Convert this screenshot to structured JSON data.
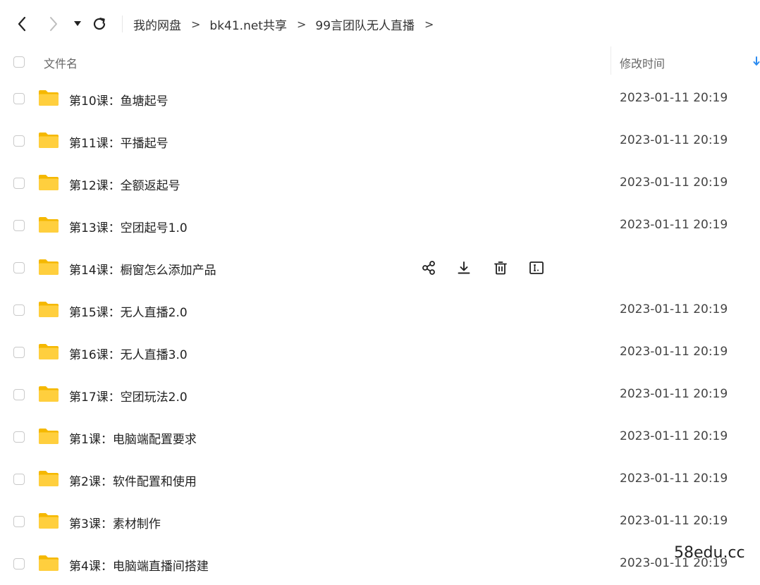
{
  "toolbar": {
    "back_icon": "chevron-left-icon",
    "forward_icon": "chevron-right-icon",
    "history_icon": "caret-down-icon",
    "refresh_icon": "refresh-icon"
  },
  "breadcrumb": {
    "items": [
      "我的网盘",
      "bk41.net共享",
      "99言团队无人直播"
    ],
    "separator": ">"
  },
  "header": {
    "name_label": "文件名",
    "time_label": "修改时间",
    "sort_icon": "sort-down-arrow-icon"
  },
  "files": [
    {
      "name": "第10课：鱼塘起号",
      "time": "2023-01-11 20:19"
    },
    {
      "name": "第11课：平播起号",
      "time": "2023-01-11 20:19"
    },
    {
      "name": "第12课：全额返起号",
      "time": "2023-01-11 20:19"
    },
    {
      "name": "第13课：空团起号1.0",
      "time": "2023-01-11 20:19"
    },
    {
      "name": "第14课：橱窗怎么添加产品",
      "time": ""
    },
    {
      "name": "第15课：无人直播2.0",
      "time": "2023-01-11 20:19"
    },
    {
      "name": "第16课：无人直播3.0",
      "time": "2023-01-11 20:19"
    },
    {
      "name": "第17课：空团玩法2.0",
      "time": "2023-01-11 20:19"
    },
    {
      "name": "第1课：电脑端配置要求",
      "time": "2023-01-11 20:19"
    },
    {
      "name": "第2课：软件配置和使用",
      "time": "2023-01-11 20:19"
    },
    {
      "name": "第3课：素材制作",
      "time": "2023-01-11 20:19"
    },
    {
      "name": "第4课：电脑端直播间搭建",
      "time": "2023-01-11 20:19"
    }
  ],
  "hover_actions": [
    "share-icon",
    "download-icon",
    "delete-icon",
    "rename-icon"
  ],
  "colors": {
    "folder": "#FFCF3E",
    "folder_back": "#F5B800",
    "accent": "#2D8CF0"
  },
  "watermark": "58edu.cc"
}
